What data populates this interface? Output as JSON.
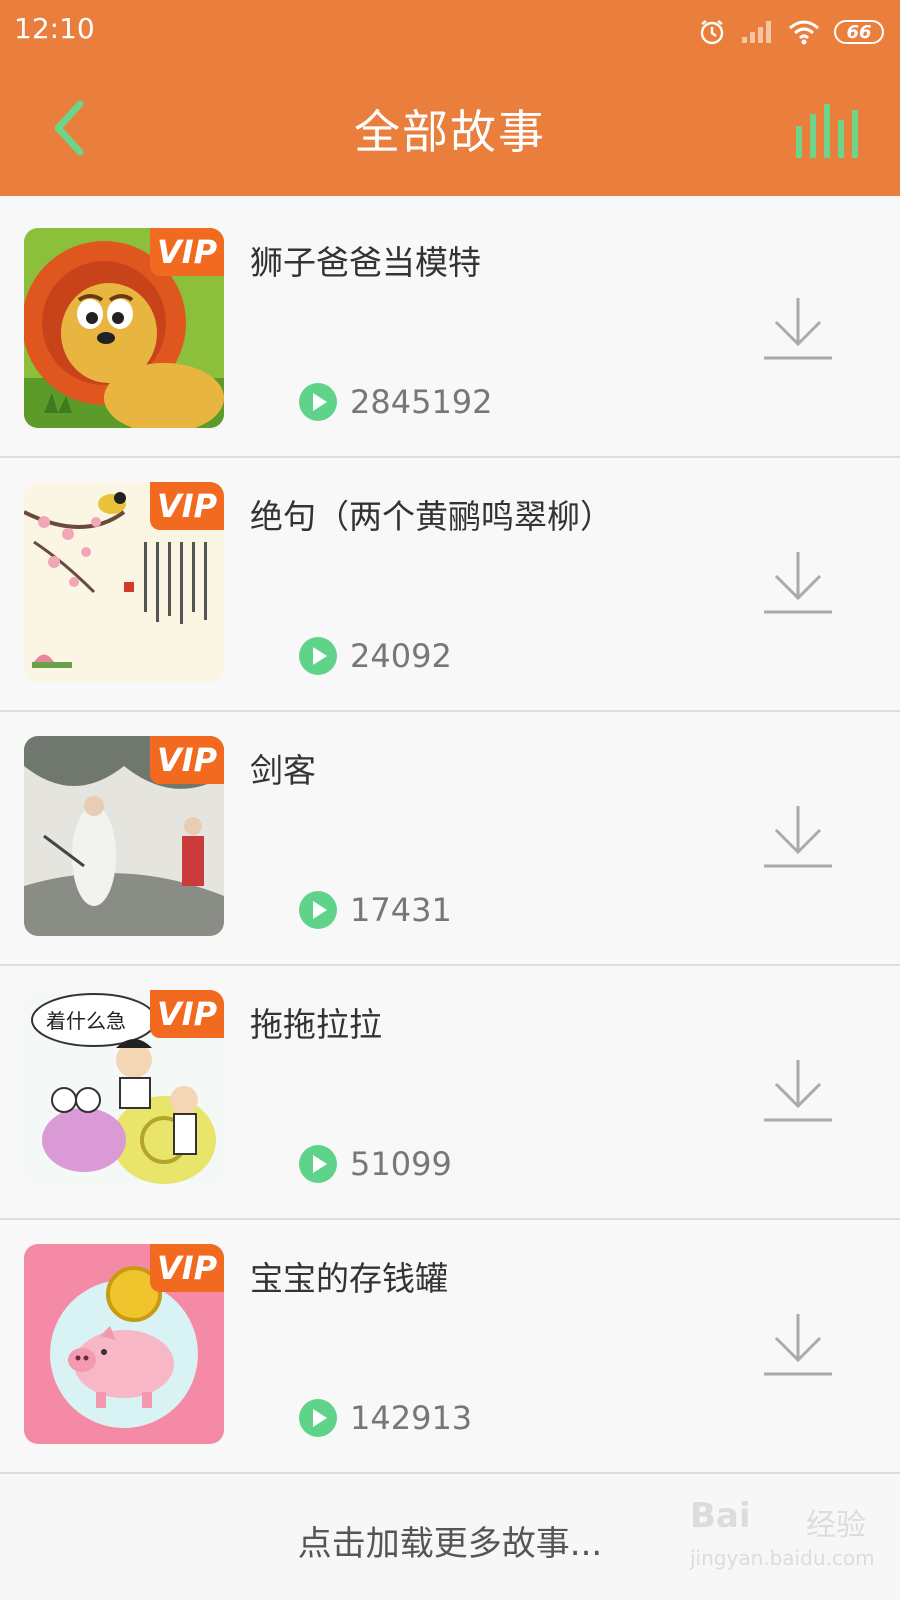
{
  "status_bar": {
    "time": "12:10",
    "battery": "66"
  },
  "header": {
    "title": "全部故事"
  },
  "stories": [
    {
      "title": "狮子爸爸当模特",
      "plays": "2845192",
      "badge": "VIP"
    },
    {
      "title": "绝句（两个黄鹂鸣翠柳）",
      "plays": "24092",
      "badge": "VIP"
    },
    {
      "title": "剑客",
      "plays": "17431",
      "badge": "VIP"
    },
    {
      "title": "拖拖拉拉",
      "plays": "51099",
      "badge": "VIP"
    },
    {
      "title": "宝宝的存钱罐",
      "plays": "142913",
      "badge": "VIP"
    }
  ],
  "thumb_texts": {
    "speech_bubble": "着什么急"
  },
  "load_more": "点击加载更多故事...",
  "watermark": {
    "brand": "Bai",
    "brand_suffix": "经验",
    "url": "jingyan.baidu.com"
  },
  "colors": {
    "header_bg": "#ea7e3c",
    "vip": "#f16a1f",
    "play_green": "#5fd38a",
    "accent_green": "#6ed48a"
  }
}
